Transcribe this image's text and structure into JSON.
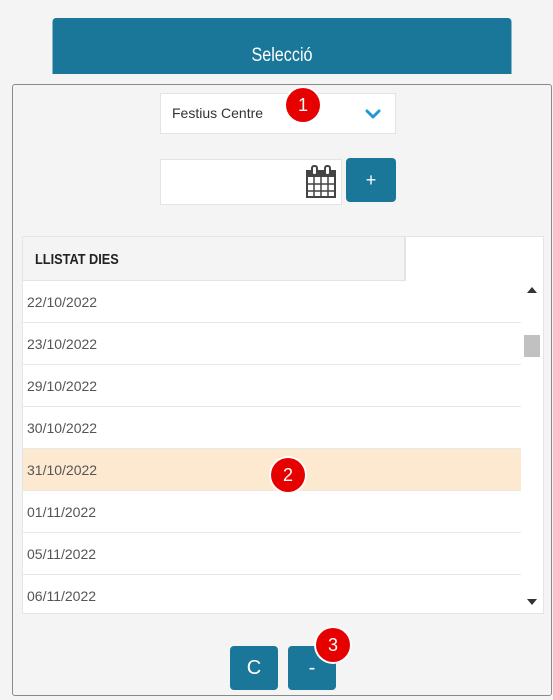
{
  "header": {
    "title": "Selecció"
  },
  "holiday_select": {
    "value": "Festius Centre"
  },
  "date_picker": {
    "value": "",
    "add_label": "+"
  },
  "list": {
    "column_header": "LLISTAT DIES",
    "rows": [
      "22/10/2022",
      "23/10/2022",
      "29/10/2022",
      "30/10/2022",
      "31/10/2022",
      "01/11/2022",
      "05/11/2022",
      "06/11/2022"
    ],
    "selected_index": 4
  },
  "buttons": {
    "clear_label": "C",
    "remove_label": "-"
  },
  "callouts": [
    "1",
    "2",
    "3"
  ],
  "colors": {
    "accent": "#1a7799",
    "selected_row": "#fde9cf",
    "callout": "#e60000"
  }
}
